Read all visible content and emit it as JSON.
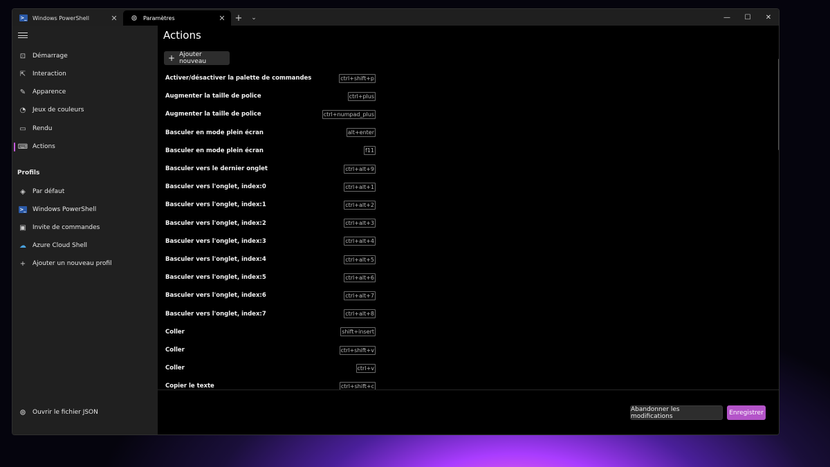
{
  "tabs": [
    {
      "label": "Windows PowerShell",
      "icon": "powershell-icon"
    },
    {
      "label": "Paramètres",
      "icon": "gear-icon"
    }
  ],
  "window_controls": {
    "minimize": "—",
    "maximize": "☐",
    "close": "✕"
  },
  "sidebar": {
    "items": [
      {
        "label": "Démarrage",
        "icon": "startup-icon"
      },
      {
        "label": "Interaction",
        "icon": "cursor-icon"
      },
      {
        "label": "Apparence",
        "icon": "brush-icon"
      },
      {
        "label": "Jeux de couleurs",
        "icon": "palette-icon"
      },
      {
        "label": "Rendu",
        "icon": "monitor-icon"
      },
      {
        "label": "Actions",
        "icon": "keyboard-icon",
        "selected": true
      }
    ],
    "profiles_header": "Profils",
    "profiles": [
      {
        "label": "Par défaut",
        "icon": "layers-icon"
      },
      {
        "label": "Windows PowerShell",
        "icon": "powershell-icon"
      },
      {
        "label": "Invite de commandes",
        "icon": "cmd-icon"
      },
      {
        "label": "Azure Cloud Shell",
        "icon": "azure-icon"
      },
      {
        "label": "Ajouter un nouveau profil",
        "icon": "plus-icon"
      }
    ],
    "open_json": {
      "label": "Ouvrir le fichier JSON",
      "icon": "gear-icon"
    }
  },
  "main": {
    "title": "Actions",
    "add_button": "Ajouter nouveau",
    "actions": [
      {
        "name": "Activer/désactiver la palette de commandes",
        "key": "ctrl+shift+p"
      },
      {
        "name": "Augmenter la taille de police",
        "key": "ctrl+plus"
      },
      {
        "name": "Augmenter la taille de police",
        "key": "ctrl+numpad_plus"
      },
      {
        "name": "Basculer en mode plein écran",
        "key": "alt+enter"
      },
      {
        "name": "Basculer en mode plein écran",
        "key": "f11"
      },
      {
        "name": "Basculer vers le dernier onglet",
        "key": "ctrl+alt+9"
      },
      {
        "name": "Basculer vers l'onglet, index:0",
        "key": "ctrl+alt+1"
      },
      {
        "name": "Basculer vers l'onglet, index:1",
        "key": "ctrl+alt+2"
      },
      {
        "name": "Basculer vers l'onglet, index:2",
        "key": "ctrl+alt+3"
      },
      {
        "name": "Basculer vers l'onglet, index:3",
        "key": "ctrl+alt+4"
      },
      {
        "name": "Basculer vers l'onglet, index:4",
        "key": "ctrl+alt+5"
      },
      {
        "name": "Basculer vers l'onglet, index:5",
        "key": "ctrl+alt+6"
      },
      {
        "name": "Basculer vers l'onglet, index:6",
        "key": "ctrl+alt+7"
      },
      {
        "name": "Basculer vers l'onglet, index:7",
        "key": "ctrl+alt+8"
      },
      {
        "name": "Coller",
        "key": "shift+insert"
      },
      {
        "name": "Coller",
        "key": "ctrl+shift+v"
      },
      {
        "name": "Coller",
        "key": "ctrl+v"
      },
      {
        "name": "Copier le texte",
        "key": "ctrl+shift+c"
      }
    ]
  },
  "footer": {
    "discard_label": "Abandonner les modifications",
    "save_label": "Enregistrer"
  },
  "colors": {
    "accent": "#b454c9",
    "sidebar_bg": "#202020",
    "main_bg": "#000000"
  }
}
